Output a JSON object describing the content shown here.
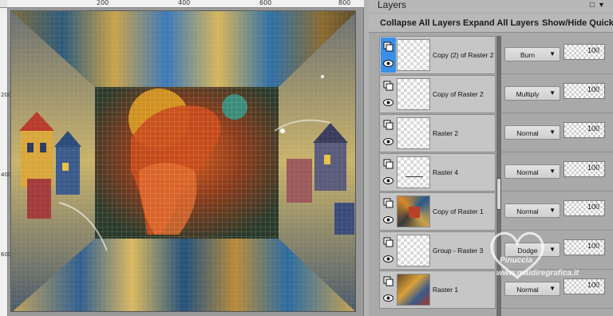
{
  "panel": {
    "title": "Layers",
    "toolbar": {
      "collapse_all": "Collapse All Layers",
      "expand_all": "Expand All Layers",
      "show_hide": "Show/Hide Quick"
    }
  },
  "layers": [
    {
      "name": "Copy (2) of Raster 2",
      "blend": "Burn",
      "opacity": "100",
      "selected": true,
      "thumb": "blank"
    },
    {
      "name": "Copy of Raster 2",
      "blend": "Multiply",
      "opacity": "100",
      "selected": false,
      "thumb": "blank"
    },
    {
      "name": "Raster 2",
      "blend": "Normal",
      "opacity": "100",
      "selected": false,
      "thumb": "blank"
    },
    {
      "name": "Raster 4",
      "blend": "Normal",
      "opacity": "100",
      "selected": false,
      "thumb": "line"
    },
    {
      "name": "Copy of Raster 1",
      "blend": "Normal",
      "opacity": "100",
      "selected": false,
      "thumb": "pattern"
    },
    {
      "name": "Group - Raster 3",
      "blend": "Dodge",
      "opacity": "100",
      "selected": false,
      "thumb": "blank"
    },
    {
      "name": "Raster 1",
      "blend": "Normal",
      "opacity": "100",
      "selected": false,
      "thumb": "image"
    }
  ],
  "rulers": {
    "horizontal": [
      "200",
      "400",
      "600",
      "800"
    ],
    "vertical": [
      "200",
      "400",
      "600"
    ]
  },
  "watermark": {
    "name": "Pinuccia",
    "url": "www.maidiregrafica.it"
  }
}
